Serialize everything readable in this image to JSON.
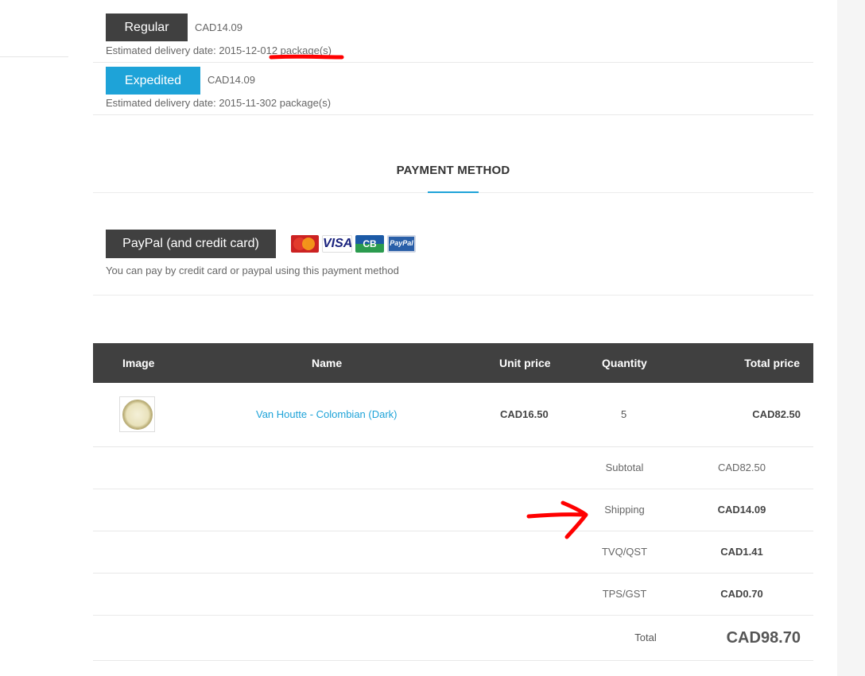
{
  "shipping": {
    "options": [
      {
        "label": "Regular",
        "price": "CAD14.09",
        "estimate": "Estimated delivery date: 2015-12-012 package(s)"
      },
      {
        "label": "Expedited",
        "price": "CAD14.09",
        "estimate": "Estimated delivery date: 2015-11-302 package(s)"
      }
    ]
  },
  "payment": {
    "title": "PAYMENT METHOD",
    "button_label": "PayPal (and credit card)",
    "description": "You can pay by credit card or paypal using this payment method",
    "card_icons": [
      "mastercard-icon",
      "visa-icon",
      "cb-icon",
      "paypal-icon"
    ],
    "card_text": {
      "visa": "VISA",
      "cb": "CB",
      "paypal": "PayPal"
    }
  },
  "cart": {
    "headers": {
      "image": "Image",
      "name": "Name",
      "unit_price": "Unit price",
      "quantity": "Quantity",
      "total_price": "Total price"
    },
    "items": [
      {
        "name": "Van Houtte - Colombian (Dark)",
        "unit_price": "CAD16.50",
        "quantity": "5",
        "total_price": "CAD82.50"
      }
    ],
    "summary": [
      {
        "label": "Subtotal",
        "value": "CAD82.50"
      },
      {
        "label": "Shipping",
        "value": "CAD14.09"
      },
      {
        "label": "TVQ/QST",
        "value": "CAD1.41"
      },
      {
        "label": "TPS/GST",
        "value": "CAD0.70"
      }
    ],
    "total": {
      "label": "Total",
      "value": "CAD98.70"
    }
  },
  "colors": {
    "accent": "#1ea3d8",
    "dark_button": "#404040",
    "annotation": "#ff0000"
  }
}
